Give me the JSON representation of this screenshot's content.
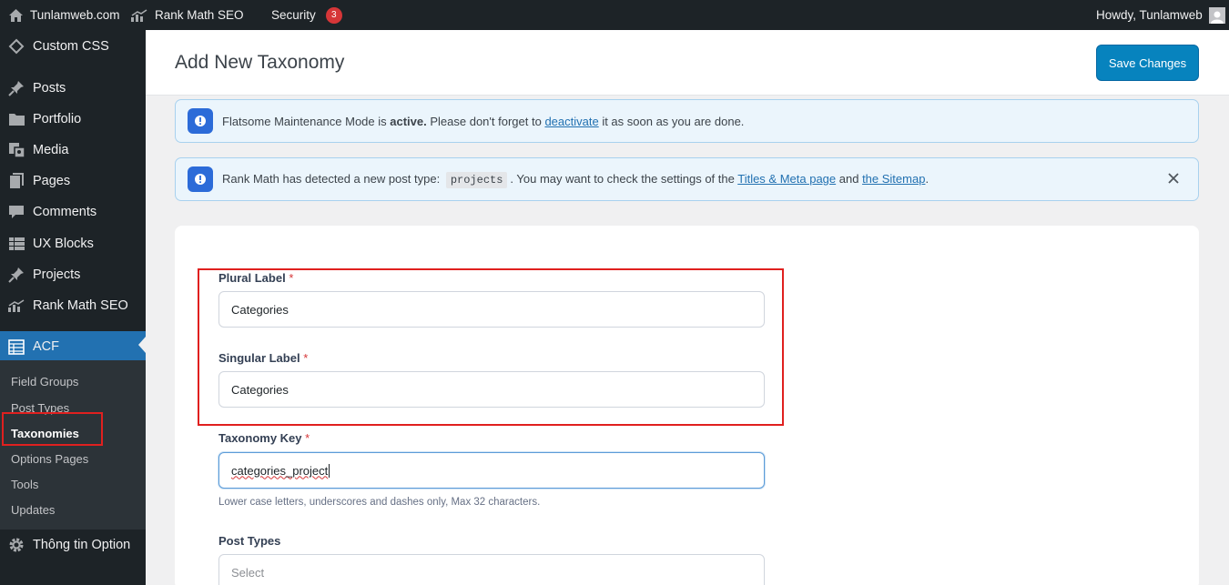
{
  "admin_bar": {
    "site_name": "Tunlamweb.com",
    "rank_math": "Rank Math SEO",
    "security": "Security",
    "security_count": "3",
    "greeting": "Howdy, Tunlamweb"
  },
  "sidebar": {
    "items": [
      {
        "label": "Custom CSS",
        "icon": "brush-icon"
      },
      {
        "label": "Posts",
        "icon": "pin-icon"
      },
      {
        "label": "Portfolio",
        "icon": "folder-icon"
      },
      {
        "label": "Media",
        "icon": "media-icon"
      },
      {
        "label": "Pages",
        "icon": "pages-icon"
      },
      {
        "label": "Comments",
        "icon": "comment-icon"
      },
      {
        "label": "UX Blocks",
        "icon": "blocks-icon"
      },
      {
        "label": "Projects",
        "icon": "pin-icon"
      },
      {
        "label": "Rank Math SEO",
        "icon": "chart-icon"
      },
      {
        "label": "ACF",
        "icon": "table-icon"
      },
      {
        "label": "Thông tin Option",
        "icon": "gear-icon"
      }
    ],
    "acf_submenu": [
      "Field Groups",
      "Post Types",
      "Taxonomies",
      "Options Pages",
      "Tools",
      "Updates"
    ],
    "active_submenu": "Taxonomies"
  },
  "header": {
    "title": "Add New Taxonomy",
    "save_label": "Save Changes"
  },
  "notices": {
    "maintenance": {
      "prefix": "Flatsome Maintenance Mode is ",
      "strong": "active.",
      "middle": " Please don't forget to ",
      "link": "deactivate",
      "suffix": " it as soon as you are done."
    },
    "rankmath": {
      "prefix": "Rank Math has detected a new post type: ",
      "code": "projects",
      "middle": ". You may want to check the settings of the ",
      "link1": "Titles & Meta page",
      "and": " and ",
      "link2": "the Sitemap",
      "suffix": "."
    }
  },
  "form": {
    "plural_label": "Plural Label",
    "plural_value": "Categories",
    "singular_label": "Singular Label",
    "singular_value": "Categories",
    "key_label": "Taxonomy Key",
    "key_value": "categories_project",
    "key_hint": "Lower case letters, underscores and dashes only, Max 32 characters.",
    "post_types_label": "Post Types",
    "post_types_placeholder": "Select",
    "required_mark": "*"
  },
  "colors": {
    "admin_bg": "#1d2327",
    "accent": "#2271b1",
    "save_button": "#0783be",
    "highlight": "#e0201f"
  }
}
